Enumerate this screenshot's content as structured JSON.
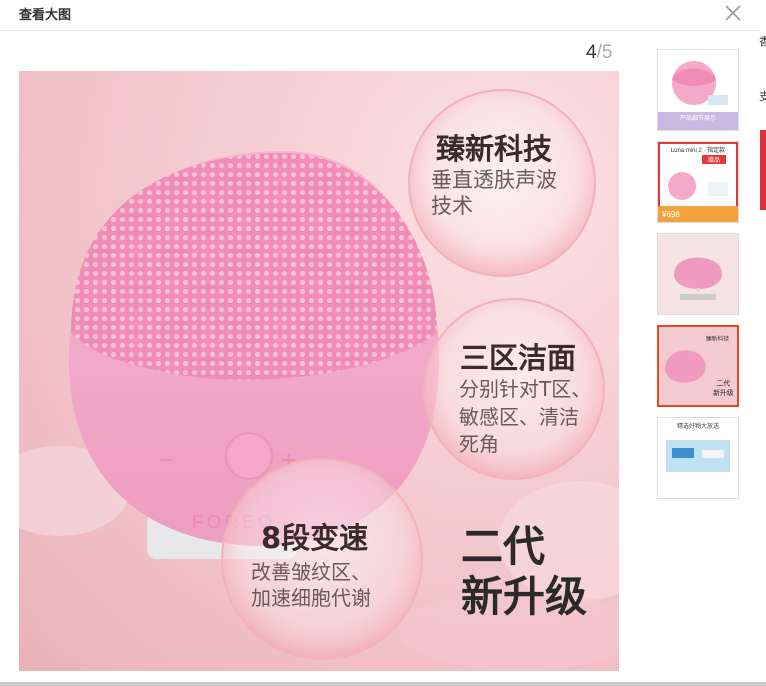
{
  "dialog": {
    "title": "查看大图"
  },
  "viewer": {
    "current": "4",
    "separator": "/",
    "total": "5"
  },
  "main_image": {
    "brand": "FOREO",
    "minus": "−",
    "plus": "+",
    "features": [
      {
        "heading": "臻新科技",
        "line1": "垂直透肤声波",
        "line2": "技术"
      },
      {
        "heading": "三区洁面",
        "line1": "分别针对T区、",
        "line2": "敏感区、清洁",
        "line3": "死角"
      },
      {
        "heading": "8段变速",
        "line1": "改善皱纹区、",
        "line2": "加速细胞代谢"
      }
    ],
    "tagline1": "二代",
    "tagline2": "新升级"
  },
  "thumbnails": [
    {
      "label": "thumb-1",
      "caption": "产品细节展示"
    },
    {
      "label": "thumb-2",
      "title": "Luna mini 2 · 指定款",
      "price": "¥698",
      "badge": "赠品"
    },
    {
      "label": "thumb-3"
    },
    {
      "label": "thumb-4",
      "text1": "臻新科技",
      "text2": "二代",
      "text3": "新升级"
    },
    {
      "label": "thumb-5",
      "title": "精选好物大放送"
    }
  ],
  "edge_text": {
    "a": "香",
    "b": "支"
  },
  "colors": {
    "accent": "#e4471d",
    "pink": "#f2a3c4"
  }
}
